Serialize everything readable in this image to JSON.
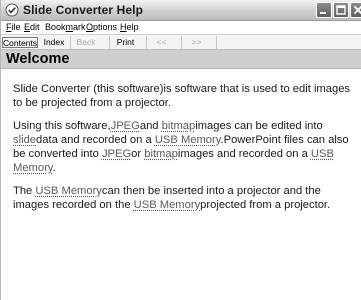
{
  "window": {
    "title": "Slide Converter Help",
    "icon": "checkmark-help-icon"
  },
  "menu": [
    {
      "label": "File",
      "key": "F",
      "rest": "ile"
    },
    {
      "label": "Edit",
      "key": "E",
      "rest": "dit"
    },
    {
      "label": "Bookmark",
      "pre": "Book",
      "key": "m",
      "rest": "ark"
    },
    {
      "label": "Options",
      "key": "O",
      "rest": "ptions"
    },
    {
      "label": "Help",
      "key": "H",
      "rest": "elp"
    }
  ],
  "toolbar": {
    "contents": "Contents",
    "index": "Index",
    "back": "Back",
    "print": "Print",
    "prev": "<<",
    "next": ">>"
  },
  "page": {
    "title": "Welcome",
    "p1": "Slide Converter (this software)is software that is used to edit images to be projected from a projector.",
    "p2": {
      "a": "Using this software,",
      "t1": "JPEG",
      "b": "and ",
      "t2": "bitmap",
      "c": "images can be edited into ",
      "t3": "slide",
      "d": "data and recorded on a ",
      "t4": "USB Memory",
      "e": ".PowerPoint files can also be converted into ",
      "t5": "JPEG",
      "f": "or ",
      "t6": "bitmap",
      "g": "images and recorded on a ",
      "t7": "USB Memory",
      "h": "."
    },
    "p3": {
      "a": "The ",
      "t1": "USB Memory",
      "b": "can then be inserted into a projector and the images recorded on the ",
      "t2": "USB Memory",
      "c": "projected from a projector."
    }
  },
  "colors": {
    "header_band": "#cfcfcf",
    "glossary_term": "#5a5a5a"
  }
}
